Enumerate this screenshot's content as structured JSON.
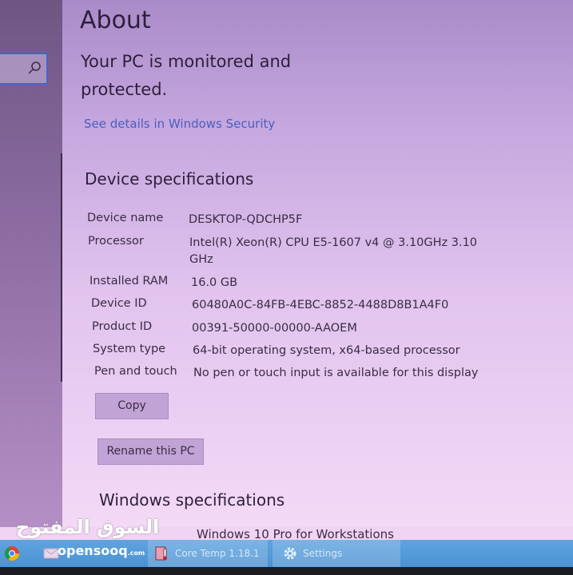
{
  "search": {
    "icon": "search-icon"
  },
  "page": {
    "title": "About",
    "protection_status": "Your PC is monitored and protected.",
    "security_link": "See details in Windows Security"
  },
  "device_specs": {
    "heading": "Device specifications",
    "rows": [
      {
        "label": "Device name",
        "value": "DESKTOP-QDCHP5F"
      },
      {
        "label": "Processor",
        "value": "Intel(R) Xeon(R) CPU E5-1607 v4 @ 3.10GHz   3.10",
        "value_line2": "GHz"
      },
      {
        "label": "Installed RAM",
        "value": "16.0 GB"
      },
      {
        "label": "Device ID",
        "value": "60480A0C-84FB-4EBC-8852-4488D8B1A4F0"
      },
      {
        "label": "Product ID",
        "value": "00391-50000-00000-AAOEM"
      },
      {
        "label": "System type",
        "value": "64-bit operating system, x64-based processor"
      },
      {
        "label": "Pen and touch",
        "value": "No pen or touch input is available for this display"
      }
    ],
    "copy_label": "Copy",
    "rename_label": "Rename this PC"
  },
  "windows_specs": {
    "heading": "Windows specifications",
    "edition": "Windows 10 Pro for Workstations"
  },
  "taskbar": {
    "items": [
      {
        "icon": "chrome-icon",
        "label": ""
      },
      {
        "icon": "mail-icon",
        "label": ""
      },
      {
        "icon": "core-temp-icon",
        "label": "Core Temp 1.18.1"
      },
      {
        "icon": "gear-icon",
        "label": "Settings"
      }
    ]
  },
  "watermark": {
    "arabic": "السوق المفتوح",
    "brand": "opensooq",
    "tld": ".com"
  }
}
